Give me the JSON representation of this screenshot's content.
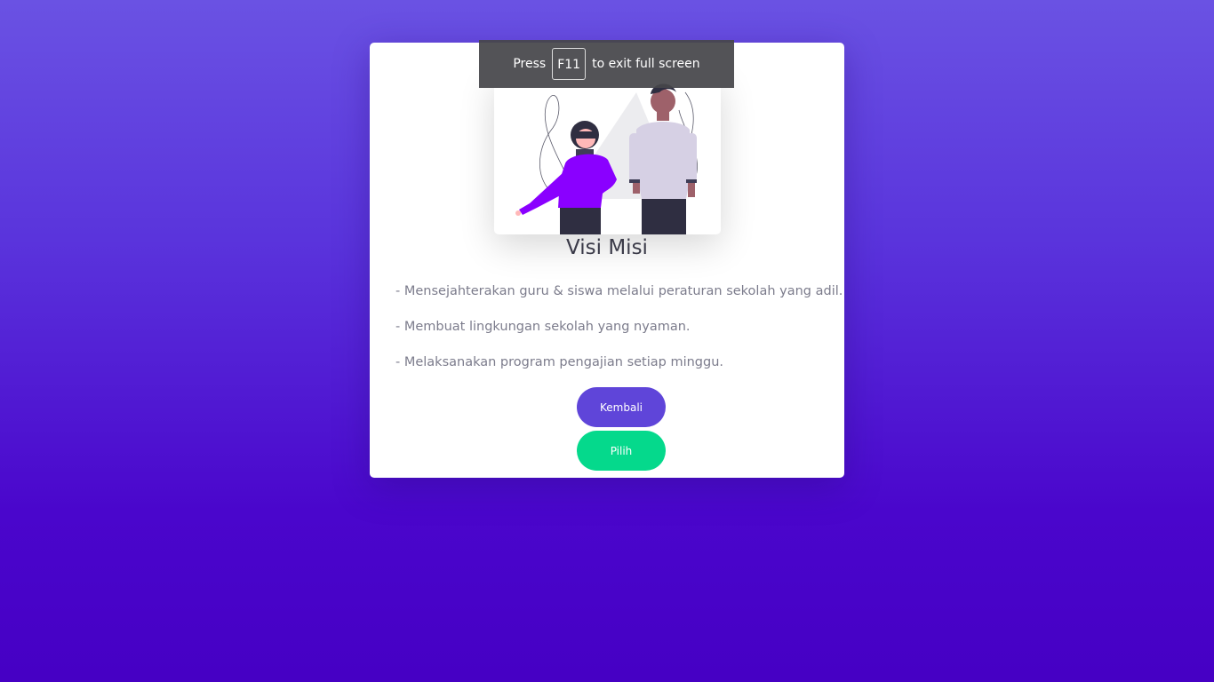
{
  "card": {
    "title": "Visi Misi",
    "items": [
      "- Mensejahterakan guru & siswa melalui peraturan sekolah yang adil.",
      "- Membuat lingkungan sekolah yang nyaman.",
      "- Melaksanakan program pengajian setiap minggu."
    ],
    "back_label": "Kembali",
    "choose_label": "Pilih"
  },
  "fullscreen_notice": {
    "before": "Press",
    "key": "F11",
    "after": "to exit full screen"
  },
  "colors": {
    "accent": "#5f45d9",
    "confirm": "#05d98c",
    "background_top": "#6a52e3",
    "background_bottom": "#4600c4"
  },
  "icons": {
    "illustration": "two-people-illustration"
  }
}
